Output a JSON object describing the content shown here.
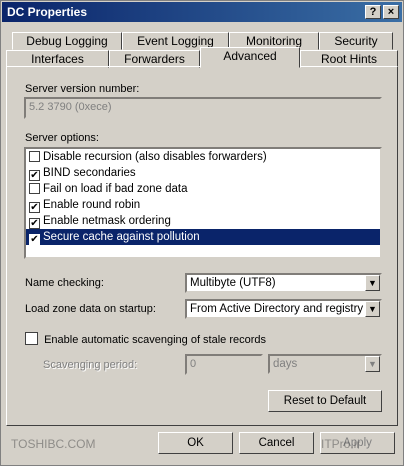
{
  "window": {
    "title": "DC Properties",
    "help_btn": "?",
    "close_btn": "×"
  },
  "tabs_back": [
    "Debug Logging",
    "Event Logging",
    "Monitoring",
    "Security"
  ],
  "tabs_front": [
    "Interfaces",
    "Forwarders",
    "Advanced",
    "Root Hints"
  ],
  "active_tab": "Advanced",
  "advanced": {
    "version_label": "Server version number:",
    "version_value": "5.2 3790 (0xece)",
    "options_label": "Server options:",
    "options": [
      {
        "label": "Disable recursion (also disables forwarders)",
        "checked": false
      },
      {
        "label": "BIND secondaries",
        "checked": true
      },
      {
        "label": "Fail on load if bad zone data",
        "checked": false
      },
      {
        "label": "Enable round robin",
        "checked": true
      },
      {
        "label": "Enable netmask ordering",
        "checked": true
      },
      {
        "label": "Secure cache against pollution",
        "checked": true
      }
    ],
    "name_checking_label": "Name checking:",
    "name_checking_value": "Multibyte (UTF8)",
    "load_zone_label": "Load zone data on startup:",
    "load_zone_value": "From Active Directory and registry",
    "scavenging_label": "Enable automatic scavenging of stale records",
    "scavenging_checked": false,
    "scavenging_period_label": "Scavenging period:",
    "scavenging_period_value": "0",
    "scavenging_unit": "days",
    "reset_button": "Reset to Default"
  },
  "footer": {
    "ok": "OK",
    "cancel": "Cancel",
    "apply": "Apply"
  },
  "watermark": {
    "left": "TOSHIBC.COM",
    "right": "ITPro.ir"
  }
}
